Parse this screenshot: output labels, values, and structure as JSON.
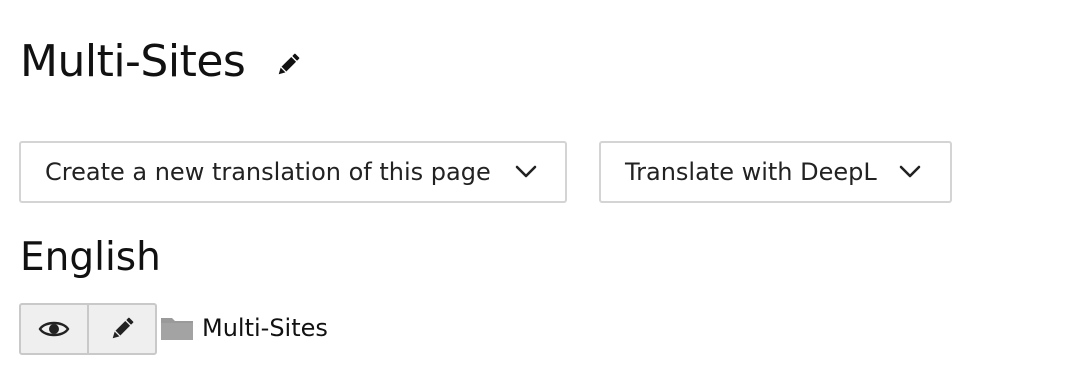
{
  "header": {
    "title": "Multi-Sites",
    "edit_icon": "pencil-icon"
  },
  "toolbar": {
    "new_translation_label": "Create a new translation of this page",
    "deepl_label": "Translate with DeepL",
    "dropdown_icon": "chevron-down-icon"
  },
  "language": {
    "heading": "English",
    "actions": [
      {
        "icon": "eye-icon",
        "purpose": "view"
      },
      {
        "icon": "pencil-icon",
        "purpose": "edit"
      }
    ],
    "entry": {
      "icon": "folder-icon",
      "label": "Multi-Sites"
    }
  },
  "colors": {
    "text": "#111111",
    "border": "#d4d4d4",
    "button_bg": "#efefef",
    "folder": "#9a9a9a"
  }
}
